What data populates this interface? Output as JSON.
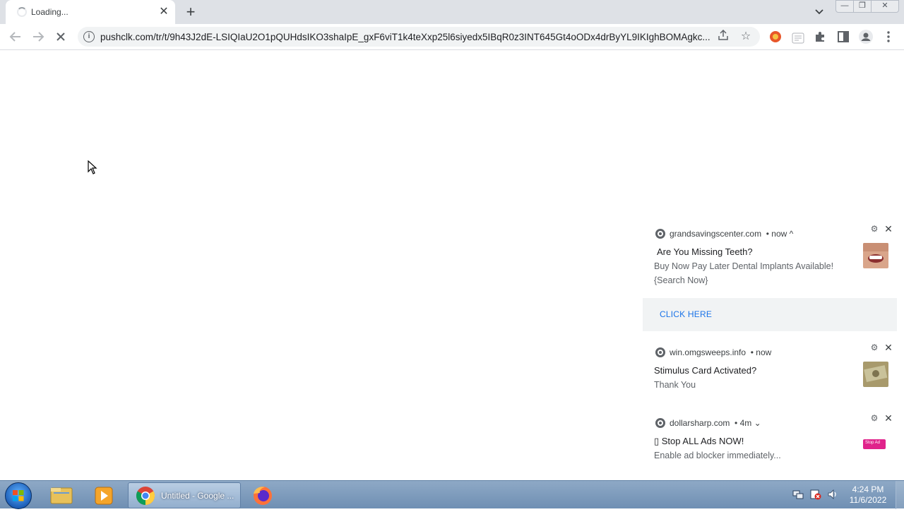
{
  "browser": {
    "tab": {
      "title": "Loading..."
    },
    "address": {
      "url": "pushclk.com/tr/t/9h43J2dE-LSIQIaU2O1pQUHdsIKO3shaIpE_gxF6viT1k4teXxp25l6siyedx5IBqR0z3INT645Gt4oODx4drByYL9IKIghBOMAgkc..."
    }
  },
  "notifications": [
    {
      "source": "grandsavingscenter.com",
      "time": "• now ^",
      "title": "Are You Missing Teeth?",
      "body_line1": "Buy Now Pay Later Dental Implants Available!",
      "body_line2": "{Search Now}",
      "action": "CLICK HERE"
    },
    {
      "source": "win.omgsweeps.info",
      "time": "• now",
      "title": "Stimulus Card Activated?",
      "body_line1": "Thank You"
    },
    {
      "source": "dollarsharp.com",
      "time": "• 4m ⌄",
      "title": "▯ Stop ALL Ads NOW!",
      "body_line1": "Enable ad blocker immediately...",
      "thumb_text": "Stop Ad"
    }
  ],
  "taskbar": {
    "chrome_label": "Untitled - Google ...",
    "time": "4:24 PM",
    "date": "11/6/2022"
  },
  "colors": {
    "accent": "#1a73e8",
    "tabstrip": "#dee1e6",
    "taskbar": "#7f9dbf"
  }
}
